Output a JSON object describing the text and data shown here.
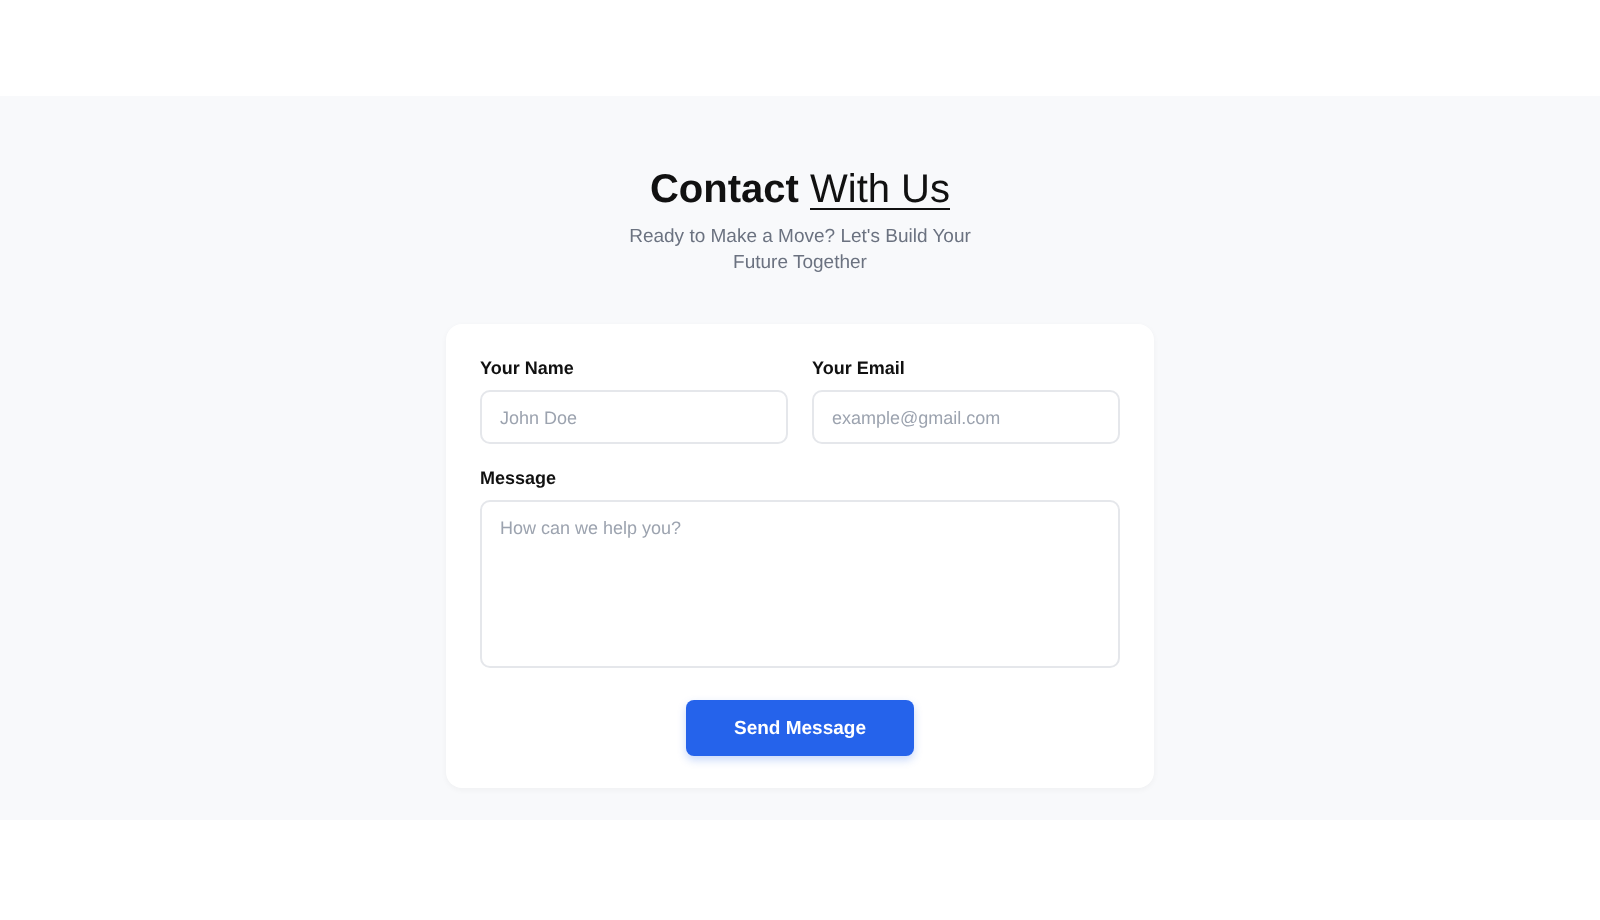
{
  "heading": {
    "strong": "Contact",
    "underlined": "With Us"
  },
  "subtitle": "Ready to Make a Move? Let's Build Your Future Together",
  "form": {
    "fields": [
      {
        "kind": "input",
        "label": "Your Name",
        "placeholder": "John Doe"
      },
      {
        "kind": "input",
        "label": "Your Email",
        "placeholder": "example@gmail.com"
      },
      {
        "kind": "textarea",
        "label": "Message",
        "placeholder": "How can we help you?"
      }
    ],
    "submit": "Send Message"
  }
}
